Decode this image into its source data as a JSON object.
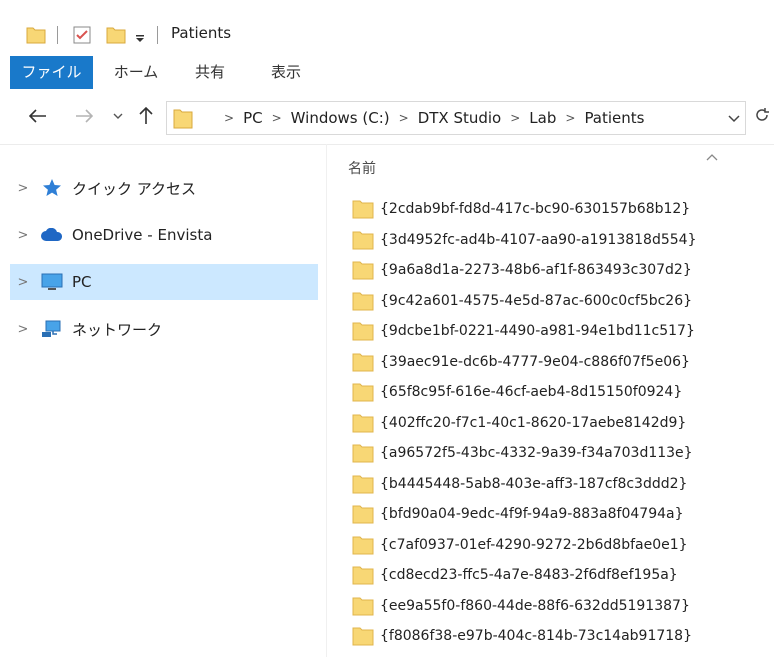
{
  "window": {
    "title": "Patients"
  },
  "ribbon": {
    "tabs": [
      "ファイル",
      "ホーム",
      "共有",
      "表示"
    ],
    "active_tab": "ファイル",
    "accent_color": "#1979ca"
  },
  "address_bar": {
    "breadcrumbs": [
      "PC",
      "Windows (C:)",
      "DTX Studio",
      "Lab",
      "Patients"
    ]
  },
  "navigation_pane": {
    "items": [
      {
        "label": "クイック アクセス",
        "icon": "star-icon"
      },
      {
        "label": "OneDrive - Envista",
        "icon": "cloud-icon"
      },
      {
        "label": "PC",
        "icon": "monitor-icon",
        "selected": true
      },
      {
        "label": "ネットワーク",
        "icon": "network-icon"
      }
    ]
  },
  "file_list": {
    "column_header": "名前",
    "items": [
      "{2cdab9bf-fd8d-417c-bc90-630157b68b12}",
      "{3d4952fc-ad4b-4107-aa90-a1913818d554}",
      "{9a6a8d1a-2273-48b6-af1f-863493c307d2}",
      "{9c42a601-4575-4e5d-87ac-600c0cf5bc26}",
      "{9dcbe1bf-0221-4490-a981-94e1bd11c517}",
      "{39aec91e-dc6b-4777-9e04-c886f07f5e06}",
      "{65f8c95f-616e-46cf-aeb4-8d15150f0924}",
      "{402ffc20-f7c1-40c1-8620-17aebe8142d9}",
      "{a96572f5-43bc-4332-9a39-f34a703d113e}",
      "{b4445448-5ab8-403e-aff3-187cf8c3ddd2}",
      "{bfd90a04-9edc-4f9f-94a9-883a8f04794a}",
      "{c7af0937-01ef-4290-9272-2b6d8bfae0e1}",
      "{cd8ecd23-ffc5-4a7e-8483-2f6df8ef195a}",
      "{ee9a55f0-f860-44de-88f6-632dd5191387}",
      "{f8086f38-e97b-404c-814b-73c14ab91718}"
    ]
  },
  "colors": {
    "folder": "#f8d775",
    "selected_nav": "#cce8ff"
  }
}
